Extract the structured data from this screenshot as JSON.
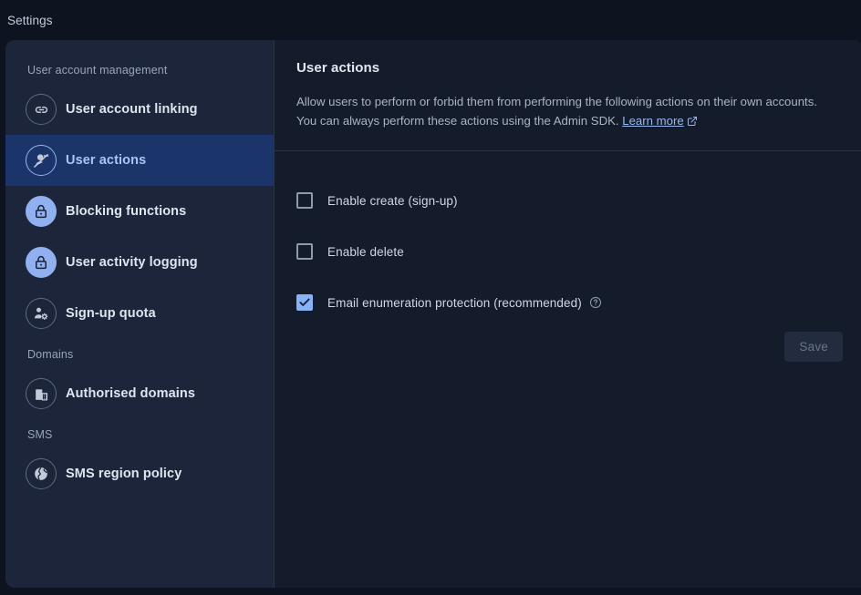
{
  "topbar": {
    "title": "Settings"
  },
  "colors": {
    "page_bg": "#0d131f",
    "card_bg": "#141c2b",
    "sidebar_bg": "#1c2539",
    "active_nav_bg": "#1b356b",
    "accent": "#8ab0f5",
    "link": "#9ab8f0",
    "icon_filled_bg": "#91b0f0"
  },
  "sidebar": {
    "groups": [
      {
        "label": "User account management",
        "items": [
          {
            "label": "User account linking",
            "icon": "link-icon",
            "icon_style": "outline",
            "active": false
          },
          {
            "label": "User actions",
            "icon": "user-blocked-icon",
            "icon_style": "outline",
            "active": true
          },
          {
            "label": "Blocking functions",
            "icon": "lock-icon",
            "icon_style": "filled",
            "active": false
          },
          {
            "label": "User activity logging",
            "icon": "lock-icon",
            "icon_style": "filled",
            "active": false
          },
          {
            "label": "Sign-up quota",
            "icon": "user-gear-icon",
            "icon_style": "outline",
            "active": false
          }
        ]
      },
      {
        "label": "Domains",
        "items": [
          {
            "label": "Authorised domains",
            "icon": "building-icon",
            "icon_style": "outline",
            "active": false
          }
        ]
      },
      {
        "label": "SMS",
        "items": [
          {
            "label": "SMS region policy",
            "icon": "globe-icon",
            "icon_style": "outline",
            "active": false
          }
        ]
      }
    ]
  },
  "main": {
    "title": "User actions",
    "description_line1": "Allow users to perform or forbid them from performing the following actions on their own accounts.",
    "description_line2": "You can always perform these actions using the Admin SDK.",
    "learn_more_label": "Learn more",
    "learn_more_icon": "external-link-icon",
    "options": [
      {
        "label": "Enable create (sign-up)",
        "checked": false,
        "help": false
      },
      {
        "label": "Enable delete",
        "checked": false,
        "help": false
      },
      {
        "label": "Email enumeration protection (recommended)",
        "checked": true,
        "help": true
      }
    ],
    "save_label": "Save",
    "save_disabled": true
  }
}
